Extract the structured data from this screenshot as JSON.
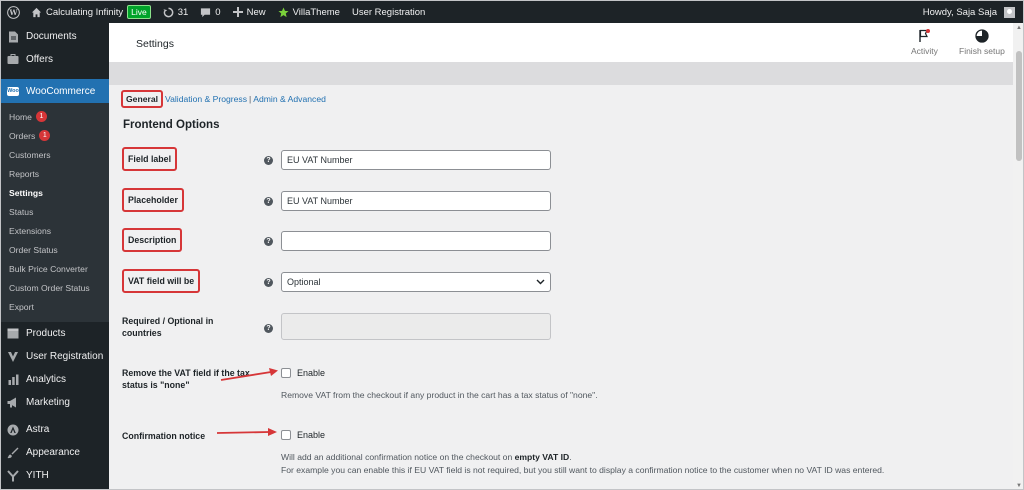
{
  "adminbar": {
    "site_name": "Calculating Infinity",
    "live_badge": "Live",
    "updates_count": "31",
    "comments_count": "0",
    "new_label": "New",
    "villatheme_label": "VillaTheme",
    "user_registration_label": "User Registration",
    "howdy": "Howdy, Saja Saja"
  },
  "sidebar": {
    "top_items": [
      {
        "label": "Documents",
        "icon": "documents-icon"
      },
      {
        "label": "Offers",
        "icon": "offers-icon"
      }
    ],
    "woocommerce_label": "WooCommerce",
    "woo_logo_text": "Woo",
    "submenu": [
      {
        "label": "Home",
        "badge": "1"
      },
      {
        "label": "Orders",
        "badge": "1"
      },
      {
        "label": "Customers"
      },
      {
        "label": "Reports"
      },
      {
        "label": "Settings",
        "current": true
      },
      {
        "label": "Status"
      },
      {
        "label": "Extensions"
      },
      {
        "label": "Order Status"
      },
      {
        "label": "Bulk Price Converter"
      },
      {
        "label": "Custom Order Status"
      },
      {
        "label": "Export"
      }
    ],
    "bottom_items": [
      {
        "label": "Products",
        "icon": "products-icon"
      },
      {
        "label": "User Registration",
        "icon": "user-registration-icon"
      },
      {
        "label": "Analytics",
        "icon": "analytics-icon"
      },
      {
        "label": "Marketing",
        "icon": "marketing-icon"
      },
      {
        "label": "Astra",
        "icon": "astra-icon"
      },
      {
        "label": "Appearance",
        "icon": "appearance-icon"
      },
      {
        "label": "YITH",
        "icon": "yith-icon"
      }
    ]
  },
  "header": {
    "title": "Settings",
    "activity_label": "Activity",
    "finish_setup_label": "Finish setup"
  },
  "tabs": {
    "general": "General",
    "validation": "Validation & Progress",
    "separator": "|",
    "admin": "Admin & Advanced"
  },
  "form": {
    "section_title": "Frontend Options",
    "field_label": {
      "label": "Field label",
      "value": "EU VAT Number"
    },
    "placeholder": {
      "label": "Placeholder",
      "value": "EU VAT Number"
    },
    "description": {
      "label": "Description",
      "value": ""
    },
    "vat_field": {
      "label": "VAT field will be",
      "selected": "Optional"
    },
    "required_optional": {
      "label_line1": "Required / Optional in",
      "label_line2": "countries"
    },
    "remove_vat": {
      "label_line1": "Remove the VAT field if the tax",
      "label_line2": "status is \"none\"",
      "checkbox_label": "Enable",
      "description": "Remove VAT from the checkout if any product in the cart has a tax status of \"none\"."
    },
    "confirmation": {
      "label": "Confirmation notice",
      "checkbox_label": "Enable",
      "description_prefix": "Will add an additional confirmation notice on the checkout on ",
      "description_bold": "empty VAT ID",
      "description_suffix": ".",
      "description_line2": "For example you can enable this if EU VAT field is not required, but you still want to display a confirmation notice to the customer when no VAT ID was entered."
    },
    "help_glyph": "?"
  },
  "colors": {
    "admin_bar": "#1d2327",
    "accent": "#2271b1",
    "highlight_red": "#d63638",
    "live_green": "#00a32a"
  }
}
